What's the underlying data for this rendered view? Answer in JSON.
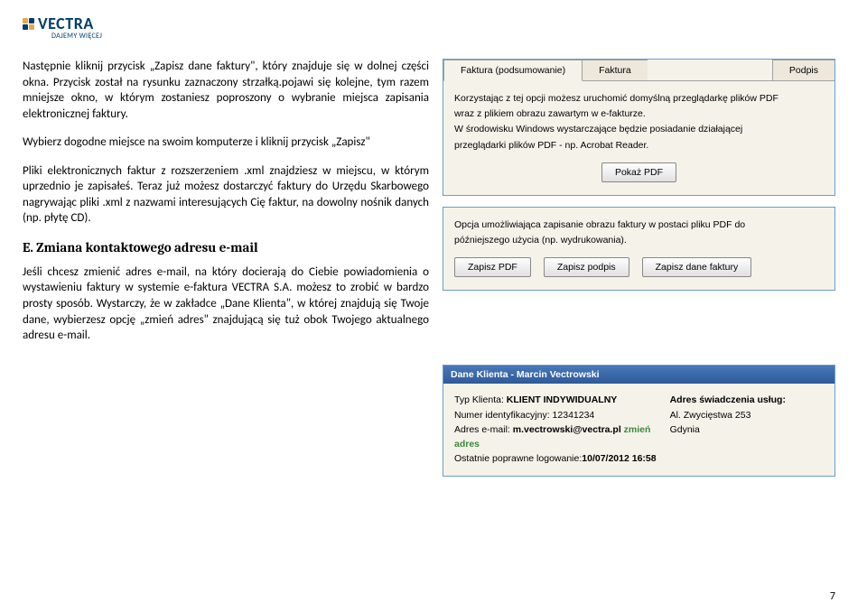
{
  "logo": {
    "brand": "VECTRA",
    "tagline": "DAJEMY WIĘCEJ"
  },
  "left": {
    "p1": "Następnie kliknij przycisk „Zapisz dane faktury\", który znajduje się w dolnej części okna. Przycisk został na rysunku zaznaczony strzałką.pojawi się kolejne, tym razem mniejsze okno, w którym zostaniesz poproszony o wybranie miejsca zapisania elektronicznej faktury.",
    "p2": "Wybierz dogodne miejsce na swoim komputerze i kliknij przycisk „Zapisz\"",
    "p3": "Pliki elektronicznych faktur z rozszerzeniem .xml znajdziesz w miejscu, w którym uprzednio je zapisałeś. Teraz już możesz dostarczyć faktury do Urzędu Skarbowego nagrywając pliki .xml z nazwami interesujących Cię faktur, na dowolny nośnik danych (np. płytę CD).",
    "heading": "E. Zmiana kontaktowego adresu e-mail",
    "p4": "Jeśli chcesz zmienić adres e-mail, na który docierają do Ciebie powiadomienia o wystawieniu faktury w systemie e-faktura VECTRA S.A. możesz to zrobić w bardzo prosty sposób. Wystarczy, że w zakładce „Dane Klienta\", w której znajdują się Twoje dane, wybierzesz opcję „zmień adres\" znajdującą się tuż obok Twojego aktualnego adresu e-mail."
  },
  "pdfPanel": {
    "tabs": [
      "Faktura (podsumowanie)",
      "Faktura",
      "Podpis"
    ],
    "line1": "Korzystając z tej opcji możesz uruchomić domyślną przeglądarkę plików PDF",
    "line2": "wraz z plikiem obrazu zawartym w e-fakturze.",
    "line3": "W środowisku Windows wystarczające będzie posiadanie działającej",
    "line4": "przeglądarki plików PDF - np. Acrobat Reader.",
    "btn": "Pokaż PDF"
  },
  "savePanel": {
    "line1": "Opcja umożliwiająca zapisanie obrazu faktury w postaci pliku PDF do",
    "line2": "późniejszego użycia (np. wydrukowania).",
    "btn1": "Zapisz PDF",
    "btn2": "Zapisz podpis",
    "btn3": "Zapisz dane faktury"
  },
  "clientPanel": {
    "title": "Dane Klienta - Marcin Vectrowski",
    "typeLabel": "Typ Klienta:",
    "typeValue": "KLIENT INDYWIDUALNY",
    "idLabel": "Numer identyfikacyjny:",
    "idValue": "12341234",
    "emailLabel": "Adres e-mail:",
    "emailValue": "m.vectrowski@vectra.pl",
    "changeLink": "zmień adres",
    "lastLoginLabel": "Ostatnie poprawne logowanie:",
    "lastLoginValue": "10/07/2012 16:58",
    "serviceAddrLabel": "Adres świadczenia usług:",
    "street": "Al. Zwycięstwa 253",
    "city": "Gdynia"
  },
  "pageNumber": "7"
}
